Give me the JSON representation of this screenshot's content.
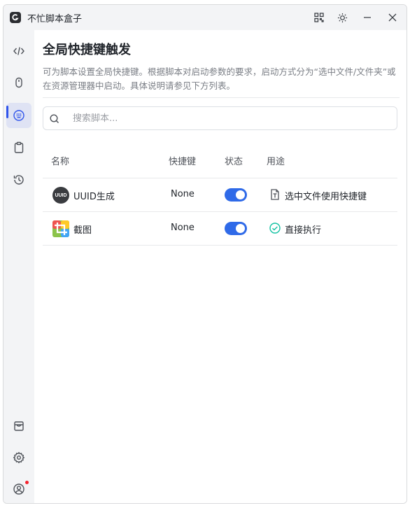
{
  "app": {
    "title": "不忙脚本盒子",
    "colors": {
      "accent": "#2f6ae8",
      "sidebar_bg": "#f3f4f6",
      "active_bg": "#dfe3f4",
      "badge": "#f5222d",
      "check": "#13c2a3"
    }
  },
  "titlebar": {
    "buttons": [
      "grid-icon",
      "theme-sun-icon",
      "minimize-icon",
      "close-icon"
    ]
  },
  "sidebar": {
    "items": [
      {
        "name": "code",
        "icon": "code-icon",
        "active": false
      },
      {
        "name": "mouse",
        "icon": "mouse-icon",
        "active": false
      },
      {
        "name": "hotkey",
        "icon": "keyboard-icon",
        "active": true
      },
      {
        "name": "clipboard",
        "icon": "clipboard-icon",
        "active": false
      },
      {
        "name": "history",
        "icon": "history-icon",
        "active": false
      }
    ],
    "bottom_items": [
      {
        "name": "store",
        "icon": "store-icon"
      },
      {
        "name": "settings",
        "icon": "gear-icon"
      },
      {
        "name": "account",
        "icon": "user-icon",
        "has_badge": true
      }
    ]
  },
  "main": {
    "title": "全局快捷键触发",
    "description": "可为脚本设置全局快捷键。根据脚本对启动参数的要求，启动方式分为“选中文件/文件夹”或在资源管理器中启动。具体说明请参见下方列表。",
    "search": {
      "placeholder": "搜索脚本...",
      "value": ""
    },
    "table": {
      "headers": {
        "name": "名称",
        "hotkey": "快捷键",
        "status": "状态",
        "usage": "用途"
      },
      "rows": [
        {
          "icon": "uuid-icon",
          "icon_text": "UUID",
          "name": "UUID生成",
          "hotkey": "None",
          "enabled": true,
          "usage_icon": "file-text-icon",
          "usage": "选中文件使用快捷键"
        },
        {
          "icon": "screenshot-icon",
          "name": "截图",
          "hotkey": "None",
          "enabled": true,
          "usage_icon": "check-circle-icon",
          "usage": "直接执行"
        }
      ]
    }
  }
}
